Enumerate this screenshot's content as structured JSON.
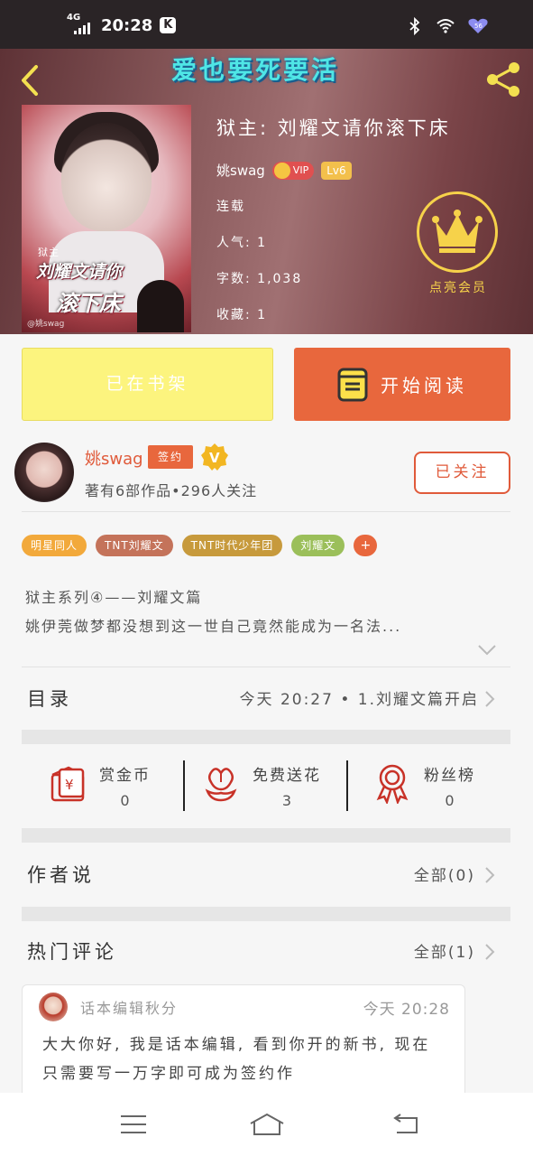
{
  "status_bar": {
    "network": "4G",
    "time": "20:28",
    "app_badge": "K",
    "battery_level": "56"
  },
  "header": {
    "app_title": "爱也要死要活"
  },
  "book": {
    "title": "狱主: 刘耀文请你滚下床",
    "author": "姚swag",
    "vip_label": "VIP",
    "level": "Lv6",
    "status": "连载",
    "popularity": "人气: 1",
    "word_count": "字数: 1,038",
    "favorites": "收藏: 1",
    "cover_tag": "狱主",
    "cover_title_line1": "刘耀文请你",
    "cover_title_line2": "滚下床",
    "cover_signature": "@姚swag"
  },
  "vip_promo": {
    "label": "点亮会员"
  },
  "actions": {
    "shelf_label": "已在书架",
    "read_label": "开始阅读"
  },
  "author_card": {
    "name": "姚swag",
    "sign_tag": "签约",
    "medal": "V",
    "works_summary": "著有6部作品•296人关注",
    "follow_label": "已关注"
  },
  "tags": [
    {
      "label": "明星同人",
      "color": "#f2a93b"
    },
    {
      "label": "TNT刘耀文",
      "color": "#c4735a"
    },
    {
      "label": "TNT时代少年团",
      "color": "#c79a3c"
    },
    {
      "label": "刘耀文",
      "color": "#9bbf5a"
    }
  ],
  "tags_more": "+",
  "description": {
    "line1": "狱主系列④——刘耀文篇",
    "line2": "姚伊莞做梦都没想到这一世自己竟然能成为一名法..."
  },
  "catalog": {
    "title": "目录",
    "latest": "今天 20:27 • 1.刘耀文篇开启"
  },
  "rewards": [
    {
      "label": "赏金币",
      "value": "0",
      "icon": "red-envelope-icon"
    },
    {
      "label": "免费送花",
      "value": "3",
      "icon": "flower-icon"
    },
    {
      "label": "粉丝榜",
      "value": "0",
      "icon": "medal-ribbon-icon"
    }
  ],
  "author_says": {
    "title": "作者说",
    "all": "全部(0)"
  },
  "hot_comments": {
    "title": "热门评论",
    "all": "全部(1)",
    "items": [
      {
        "name": "话本编辑秋分",
        "time": "今天 20:28",
        "body": "大大你好, 我是话本编辑, 看到你开的新书, 现在只需要写一万字即可成为签约作"
      }
    ]
  },
  "colors": {
    "accent": "#e8673d",
    "shelf_button": "#fcf47e",
    "vip_gold": "#f6d24a"
  }
}
